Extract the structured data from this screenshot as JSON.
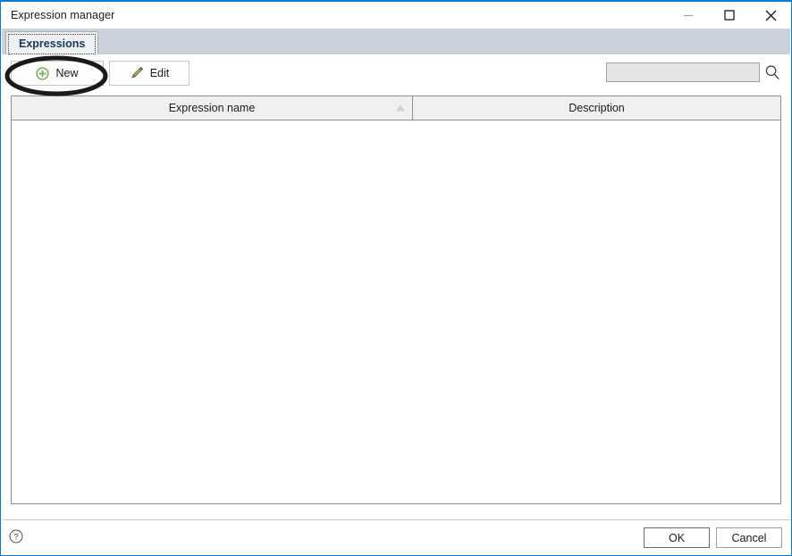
{
  "window": {
    "title": "Expression manager",
    "accent_color": "#0a7ad4",
    "controls": [
      {
        "name": "minimize",
        "glyph": "minimize-icon"
      },
      {
        "name": "maximize",
        "glyph": "maximize-icon"
      },
      {
        "name": "close",
        "glyph": "close-icon"
      }
    ]
  },
  "tabs": [
    {
      "label": "Expressions",
      "selected": true
    }
  ],
  "toolbar": {
    "new_label": "New",
    "new_icon": "plus-circle-icon",
    "new_icon_color": "#6aa84f",
    "edit_label": "Edit",
    "edit_icon": "pencil-icon",
    "edit_icon_color": "#c9b037",
    "search": {
      "value": "",
      "placeholder": "",
      "icon": "search-icon"
    }
  },
  "grid": {
    "columns": [
      {
        "header": "Expression name",
        "sort": "ascending"
      },
      {
        "header": "Description",
        "sort": ""
      }
    ],
    "rows": []
  },
  "footer": {
    "help_icon": "help-circle-icon",
    "ok_label": "OK",
    "cancel_label": "Cancel"
  },
  "annotation": {
    "shape": "ellipse-highlight",
    "target": "new-button",
    "color": "#1a1a1a"
  }
}
